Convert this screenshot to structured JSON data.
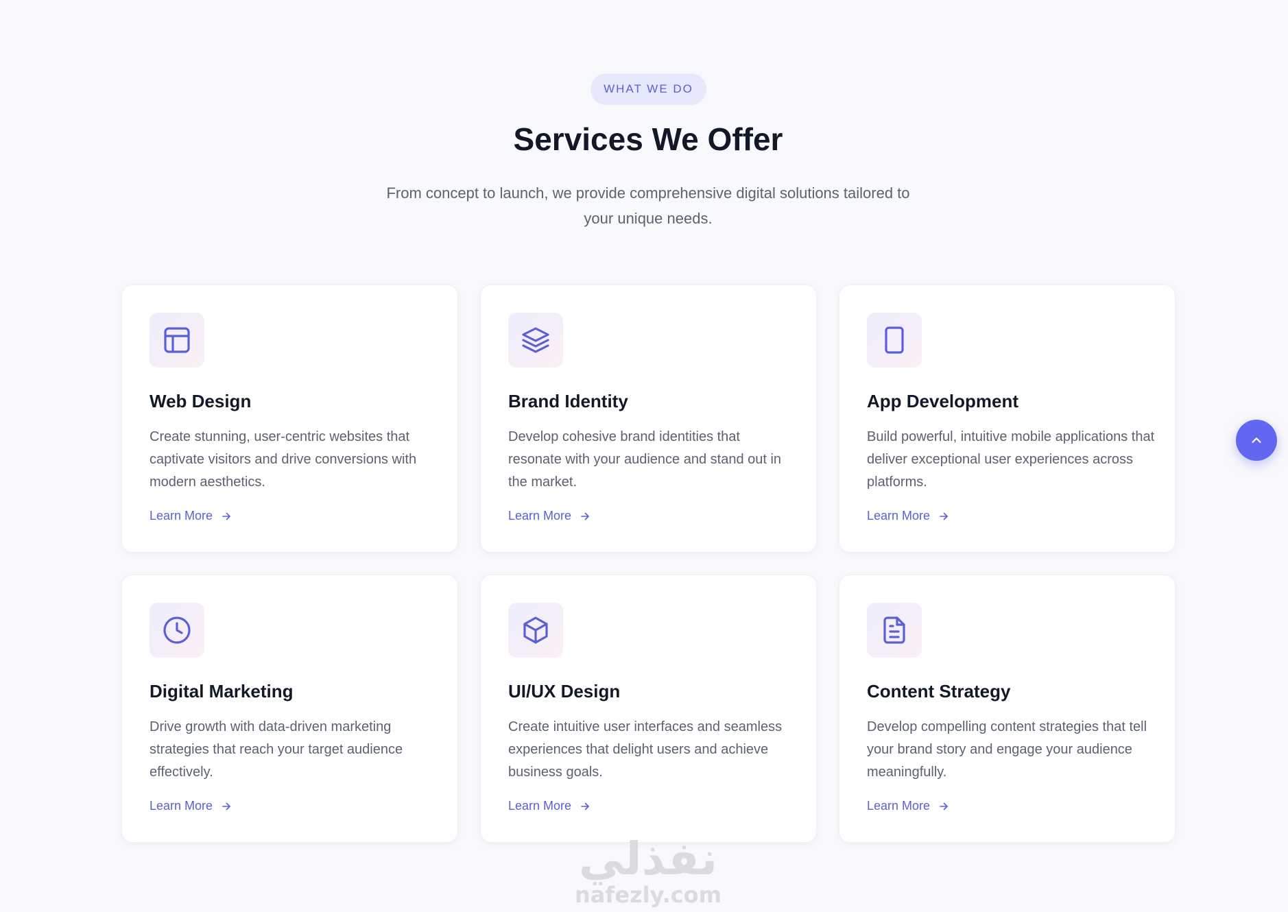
{
  "header": {
    "eyebrow": "WHAT WE DO",
    "title": "Services We Offer",
    "subtitle": "From concept to launch, we provide comprehensive digital solutions tailored to your unique needs."
  },
  "colors": {
    "accent": "#6366f1",
    "accent_text": "#5b5fd6",
    "heading": "#111827",
    "body_text": "#5b6170",
    "page_bg": "#f8f9fc"
  },
  "services": [
    {
      "icon": "layout-icon",
      "title": "Web Design",
      "description": "Create stunning, user-centric websites that captivate visitors and drive conversions with modern aesthetics.",
      "link_label": "Learn More"
    },
    {
      "icon": "layers-icon",
      "title": "Brand Identity",
      "description": "Develop cohesive brand identities that resonate with your audience and stand out in the market.",
      "link_label": "Learn More"
    },
    {
      "icon": "tablet-icon",
      "title": "App Development",
      "description": "Build powerful, intuitive mobile applications that deliver exceptional user experiences across platforms.",
      "link_label": "Learn More"
    },
    {
      "icon": "clock-icon",
      "title": "Digital Marketing",
      "description": "Drive growth with data-driven marketing strategies that reach your target audience effectively.",
      "link_label": "Learn More"
    },
    {
      "icon": "cube-icon",
      "title": "UI/UX Design",
      "description": "Create intuitive user interfaces and seamless experiences that delight users and achieve business goals.",
      "link_label": "Learn More"
    },
    {
      "icon": "document-icon",
      "title": "Content Strategy",
      "description": "Develop compelling content strategies that tell your brand story and engage your audience meaningfully.",
      "link_label": "Learn More"
    }
  ],
  "scroll_top": {
    "icon": "chevron-up-icon"
  },
  "watermark": {
    "arabic": "نفذلي",
    "latin": "nafezly.com"
  }
}
